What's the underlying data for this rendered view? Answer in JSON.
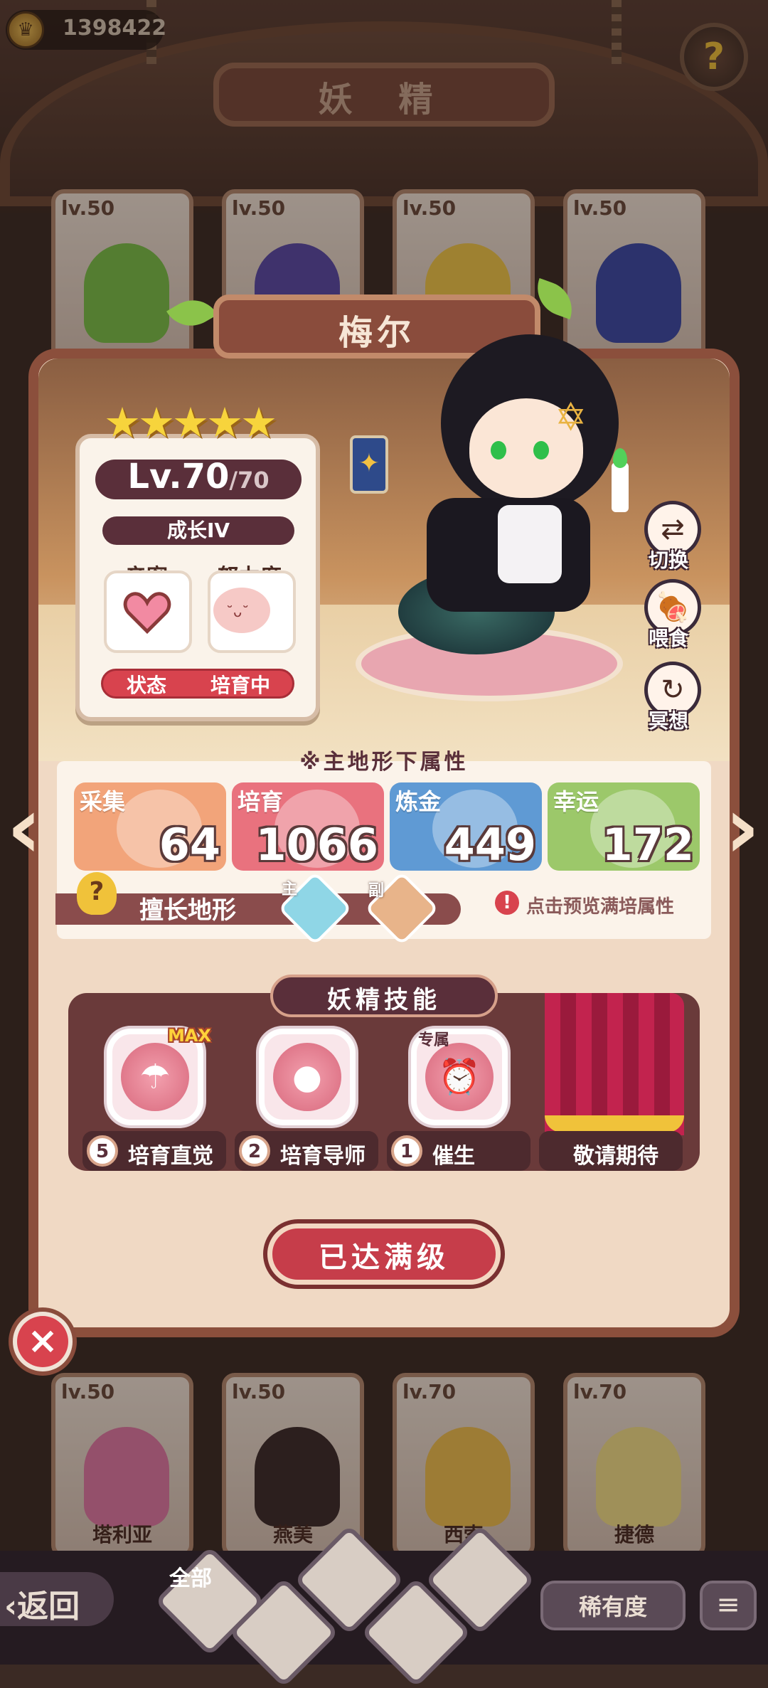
{
  "top_bar": {
    "currency_value": "1398422",
    "currency_icon": "crown-coin-icon",
    "title": "妖 精",
    "help_icon": "question-sprout-icon"
  },
  "roster_top": [
    {
      "level": "lv.50",
      "hair": "#7bc24a"
    },
    {
      "level": "lv.50",
      "hair": "#5a4aa8"
    },
    {
      "level": "lv.50",
      "hair": "#f2c84a"
    },
    {
      "level": "lv.50",
      "hair": "#3a4aa8"
    }
  ],
  "roster_bottom": [
    {
      "level": "lv.50",
      "name": "塔利亚",
      "hair": "#e27aa6"
    },
    {
      "level": "lv.50",
      "name": "燕美",
      "hair": "#3a2a2a"
    },
    {
      "level": "lv.70",
      "name": "西索",
      "hair": "#f0c050"
    },
    {
      "level": "lv.70",
      "name": "捷德",
      "hair": "#f4e08a"
    }
  ],
  "fairy": {
    "name": "梅尔",
    "stars": "★★★★★",
    "level": "Lv.70",
    "max_level": "/70",
    "growth": "成长IV",
    "intimacy_label": "亲密",
    "effort_label": "努力度",
    "status_label": "状态",
    "status_value": "培育中"
  },
  "actions": [
    {
      "label": "切换",
      "icon": "switch-arrows-icon"
    },
    {
      "label": "喂食",
      "icon": "meat-icon"
    },
    {
      "label": "冥想",
      "icon": "meditate-swirl-icon"
    }
  ],
  "stats": {
    "caption": "※主地形下属性",
    "items": [
      {
        "label": "采集",
        "value": "64",
        "color": "#f2a47a"
      },
      {
        "label": "培育",
        "value": "1066",
        "color": "#e9727e"
      },
      {
        "label": "炼金",
        "value": "449",
        "color": "#5f9ad4"
      },
      {
        "label": "幸运",
        "value": "172",
        "color": "#9cc86a"
      }
    ],
    "terrain_label": "擅长地形",
    "main_tag": "主",
    "sub_tag": "副",
    "preview_text": "点击预览满培属性",
    "prev_arrow": "‹",
    "next_arrow": "›"
  },
  "skills": {
    "title": "妖精技能",
    "items": [
      {
        "name": "培育直觉",
        "level": "5",
        "badge": "MAX",
        "icon": "watering-can-icon"
      },
      {
        "name": "培育导师",
        "level": "2",
        "badge": "",
        "icon": "tomato-upgrade-icon"
      },
      {
        "name": "催生",
        "level": "1",
        "badge": "专属",
        "icon": "alarm-clock-icon"
      },
      {
        "name": "敬请期待",
        "level": "",
        "badge": "",
        "icon": "curtain-icon"
      }
    ]
  },
  "max_button": "已达满级",
  "bottom_bar": {
    "back_label": "‹返回",
    "filter_all": "全部",
    "rarity_label": "稀有度"
  },
  "colors": {
    "panel_border": "#8b4f3c",
    "accent_red": "#c63d4a",
    "dark_plum": "#5a2f3a"
  }
}
